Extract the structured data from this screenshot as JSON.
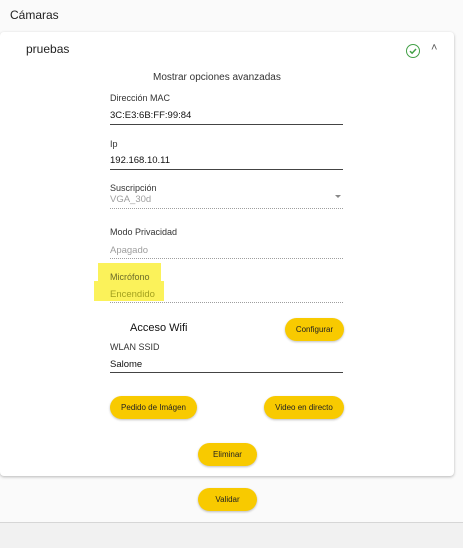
{
  "page": {
    "section_title": "Cámaras"
  },
  "camera": {
    "name": "pruebas",
    "advanced_toggle": "Mostrar opciones avanzadas",
    "mac": {
      "label": "Dirección MAC",
      "value": "3C:E3:6B:FF:99:84"
    },
    "ip": {
      "label": "Ip",
      "value": "192.168.10.11"
    },
    "subscription": {
      "label": "Suscripción",
      "value": "VGA_30d"
    },
    "privacy": {
      "label": "Modo Privacidad",
      "value": "Apagado"
    },
    "microphone": {
      "label": "Micrófono",
      "value": "Encendido"
    },
    "wifi": {
      "title": "Acceso Wifi",
      "configure_label": "Configurar",
      "ssid_label": "WLAN SSID",
      "ssid_value": "Salome"
    },
    "buttons": {
      "image_request": "Pedido de Imágen",
      "live_video": "Video en directo",
      "delete": "Eliminar"
    }
  },
  "footer": {
    "validate_label": "Validar"
  },
  "colors": {
    "accent": "#f8ca00",
    "highlight": "#fbf25a",
    "status_ok": "#43a047"
  }
}
